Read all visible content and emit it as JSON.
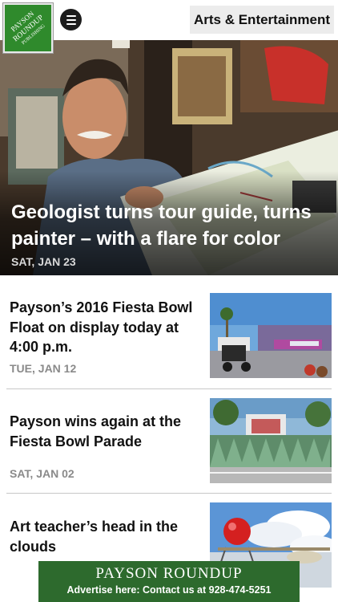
{
  "header": {
    "logo_text": [
      "PAYSON",
      "ROUNDUP",
      "PUBLISHING"
    ],
    "menu_icon": "hamburger-menu-icon",
    "section_title": "Arts & Entertainment"
  },
  "hero": {
    "title": "Geologist turns tour guide, turns painter – with a flare for color",
    "date": "SAT, JAN 23"
  },
  "articles": [
    {
      "title": "Payson’s 2016 Fiesta Bowl Float on display today at 4:00 p.m.",
      "date": "TUE, JAN 12"
    },
    {
      "title": "Payson wins again at the Fiesta Bowl Parade",
      "date": "SAT, JAN 02"
    },
    {
      "title": "Art teacher’s head in the clouds",
      "date": ""
    }
  ],
  "ad": {
    "brand": "PAYSON ROUNDUP",
    "text": "Advertise here: Contact us at 928-474-5251"
  },
  "colors": {
    "brand_green": "#2f8a2c",
    "ad_green": "#2d6a2d",
    "date_gray": "#8a8a8a"
  }
}
